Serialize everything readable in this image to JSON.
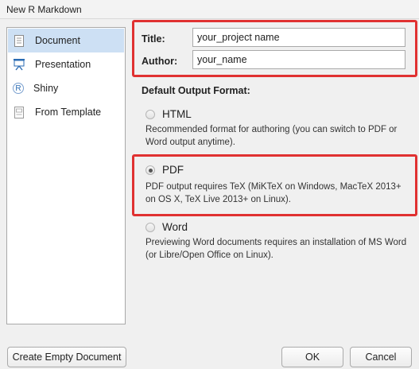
{
  "window": {
    "title": "New R Markdown"
  },
  "sidebar": {
    "items": [
      {
        "label": "Document",
        "icon": "document-icon",
        "selected": true
      },
      {
        "label": "Presentation",
        "icon": "presentation-icon",
        "selected": false
      },
      {
        "label": "Shiny",
        "icon": "shiny-icon",
        "selected": false,
        "icon_text": "R"
      },
      {
        "label": "From Template",
        "icon": "template-icon",
        "selected": false
      }
    ]
  },
  "form": {
    "title_label": "Title:",
    "title_value": "your_project name",
    "author_label": "Author:",
    "author_value": "your_name"
  },
  "output_format": {
    "heading": "Default Output Format:",
    "options": [
      {
        "label": "HTML",
        "selected": false,
        "description": "Recommended format for authoring (you can switch to PDF or Word output anytime)."
      },
      {
        "label": "PDF",
        "selected": true,
        "description": "PDF output requires TeX (MiKTeX on Windows, MacTeX 2013+ on OS X, TeX Live 2013+ on Linux)."
      },
      {
        "label": "Word",
        "selected": false,
        "description": "Previewing Word documents requires an installation of MS Word (or Libre/Open Office on Linux)."
      }
    ]
  },
  "buttons": {
    "create_empty": "Create Empty Document",
    "ok": "OK",
    "cancel": "Cancel"
  },
  "colors": {
    "highlight_box": "#e03131",
    "selected_item": "#cde0f4"
  }
}
